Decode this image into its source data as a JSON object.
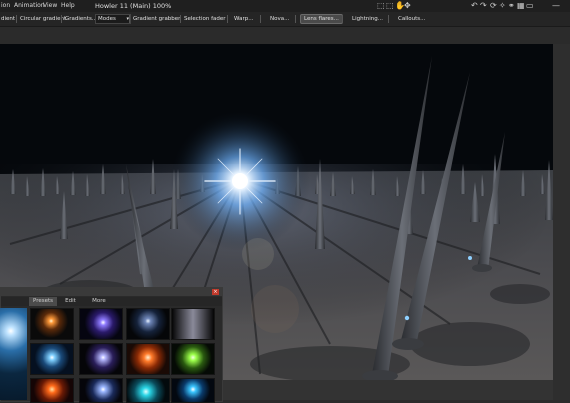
{
  "menu": {
    "items": [
      "ion",
      "Animation",
      "View",
      "Help"
    ],
    "window_title": "Howler 11  (Main)  100%"
  },
  "toolbar": {
    "items": [
      "dient",
      "Circular gradient",
      "Gradients...",
      "Modes",
      "Gradient grabber",
      "Selection fader",
      "Warp...",
      "Nova...",
      "Lens flares...",
      "Lightning...",
      "Callouts..."
    ],
    "active_item": "Lens flares..."
  },
  "lens_dialog": {
    "tabs": [
      "Presets",
      "Edit",
      "More"
    ],
    "selected_tab": "Presets",
    "close_icon": "close-icon"
  },
  "icons": {
    "toolbar_icons": [
      "select-icon",
      "select-alt-icon",
      "hand-icon",
      "move-icon",
      "undo-icon",
      "redo-icon",
      "transform-icon",
      "star-icon",
      "link-icon",
      "grid-icon",
      "window-icon"
    ]
  },
  "colors": {
    "background": "#2b2b2b",
    "toolbar": "#252525",
    "close_button": "#c0392b"
  }
}
